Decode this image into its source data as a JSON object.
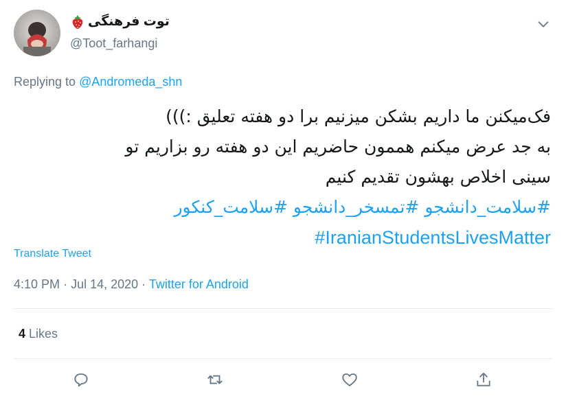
{
  "author": {
    "display_name": "توت فرهنگی",
    "handle": "@Toot_farhangi"
  },
  "reply": {
    "prefix": "Replying to",
    "mention": "@Andromeda_shn"
  },
  "tweet": {
    "lines": [
      "فک‌میکنن ما داریم بشکن میزنیم برا دو هفته تعلیق :)))",
      "به جد عرض میکنم هممون حاضریم این دو هفته رو بزاریم تو",
      "سینی اخلاص بهشون تقدیم کنیم"
    ],
    "hashtags_fa": "#سلامت_دانشجو #تمسخر_دانشجو #سلامت_کنکور",
    "hashtag_en": "#IranianStudentsLivesMatter"
  },
  "translate_label": "Translate Tweet",
  "meta": {
    "time": "4:10 PM",
    "separator": "·",
    "date": "Jul 14, 2020",
    "source": "Twitter for Android"
  },
  "likes": {
    "count": "4",
    "label": "Likes"
  },
  "colors": {
    "accent": "#1da1f2",
    "secondary_text": "#657786",
    "primary_text": "#14171a",
    "divider": "#e6ecf0"
  },
  "icons": {
    "more": "chevron-down-icon",
    "reply": "reply-icon",
    "retweet": "retweet-icon",
    "like": "heart-icon",
    "share": "share-icon",
    "emoji": "strawberry-icon"
  }
}
